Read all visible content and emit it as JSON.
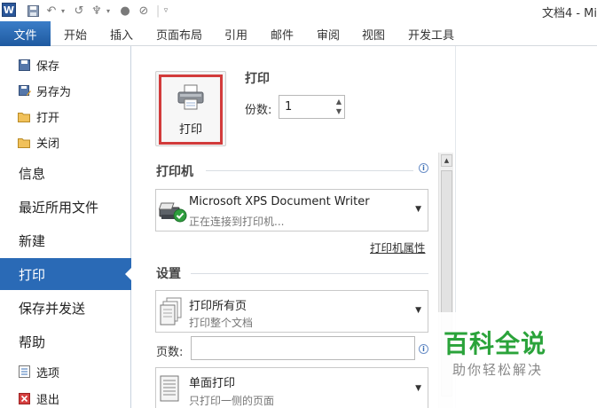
{
  "titlebar": {
    "app_logo_letter": "W",
    "doc_title": "文档4 - Mi"
  },
  "tabs": [
    "文件",
    "开始",
    "插入",
    "页面布局",
    "引用",
    "邮件",
    "审阅",
    "视图",
    "开发工具"
  ],
  "nav": {
    "save": "保存",
    "save_as": "另存为",
    "open": "打开",
    "close": "关闭",
    "info": "信息",
    "recent": "最近所用文件",
    "new": "新建",
    "print": "打印",
    "save_send": "保存并发送",
    "help": "帮助",
    "options": "选项",
    "exit": "退出"
  },
  "print": {
    "button_label": "打印",
    "section_title": "打印",
    "copies_label": "份数:",
    "copies_value": "1"
  },
  "printer": {
    "section_title": "打印机",
    "name": "Microsoft XPS Document Writer",
    "status": "正在连接到打印机...",
    "properties_link": "打印机属性"
  },
  "settings": {
    "section_title": "设置",
    "range_title": "打印所有页",
    "range_sub": "打印整个文档",
    "pages_label": "页数:",
    "pages_value": "",
    "sides_title": "单面打印",
    "sides_sub": "只打印一侧的页面"
  },
  "watermark": {
    "title": "百科全说",
    "subtitle": "助你轻松解决"
  },
  "colors": {
    "accent": "#2a6ab6",
    "highlight_border": "#d23b3b",
    "watermark_green": "#2aa33a"
  }
}
